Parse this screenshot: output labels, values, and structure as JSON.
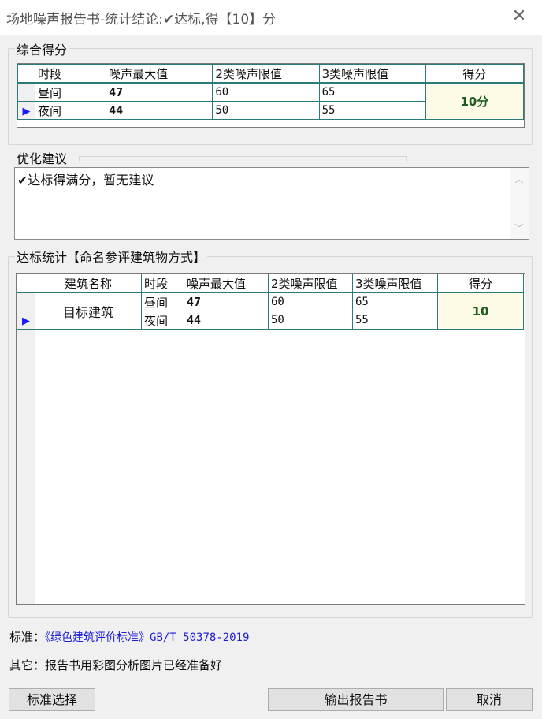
{
  "window": {
    "title": "场地噪声报告书-统计结论:✔达标,得【10】分",
    "close_glyph": "✕"
  },
  "summary": {
    "legend": "综合得分",
    "headers": [
      "时段",
      "噪声最大值",
      "2类噪声限值",
      "3类噪声限值",
      "得分"
    ],
    "rows": [
      {
        "period": "昼间",
        "max": "47",
        "limit2": "60",
        "limit3": "65"
      },
      {
        "period": "夜间",
        "max": "44",
        "limit2": "50",
        "limit3": "55"
      }
    ],
    "score": "10分"
  },
  "advice": {
    "legend": "优化建议",
    "text": "✔达标得满分，暂无建议"
  },
  "stats": {
    "legend": "达标统计【命名参评建筑物方式】",
    "headers": [
      "建筑名称",
      "时段",
      "噪声最大值",
      "2类噪声限值",
      "3类噪声限值",
      "得分"
    ],
    "building": "目标建筑",
    "rows": [
      {
        "period": "昼间",
        "max": "47",
        "limit2": "60",
        "limit3": "65"
      },
      {
        "period": "夜间",
        "max": "44",
        "limit2": "50",
        "limit3": "55"
      }
    ],
    "score": "10"
  },
  "footer": {
    "standard_label": "标准：",
    "standard_value": "《绿色建筑评价标准》GB/T 50378-2019",
    "other_label": "其它：",
    "other_value": "报告书用彩图分析图片已经准备好"
  },
  "buttons": {
    "select_standard": "标准选择",
    "export_report": "输出报告书",
    "cancel": "取消"
  },
  "colors": {
    "link": "#1a1adb",
    "score_bg": "#fdfbe6",
    "score_text": "#1b5e20",
    "grid_line": "#2a7a7a"
  }
}
